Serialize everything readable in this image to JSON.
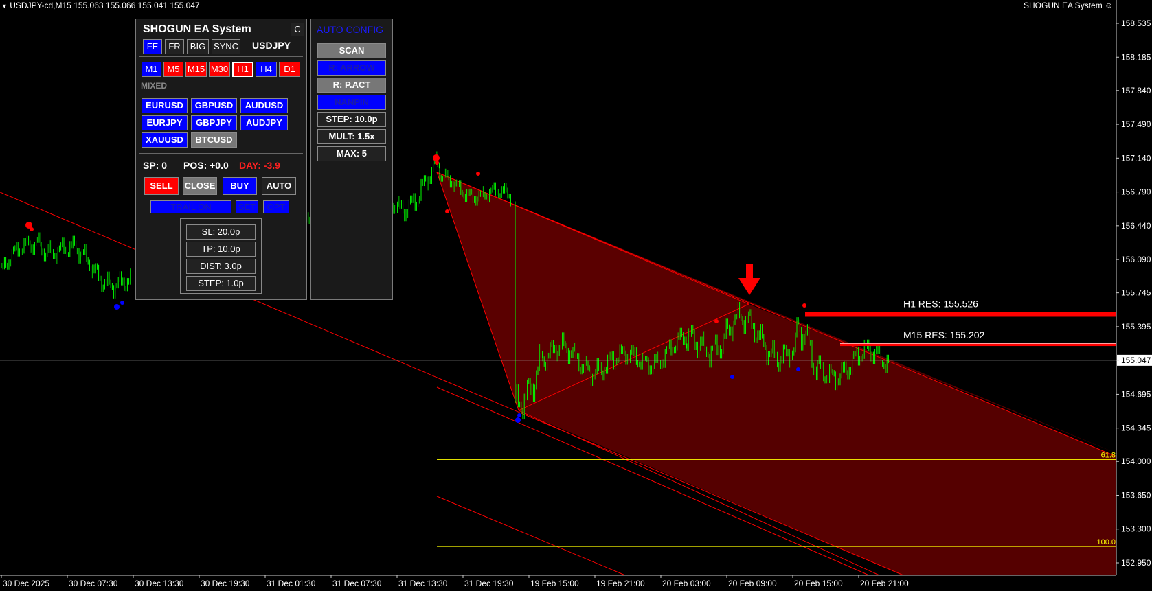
{
  "header": {
    "symbol_info": "USDJPY-cd,M15  155.063 155.066 155.041 155.047",
    "ea_label": "SHOGUN EA System ☺"
  },
  "chart_data": {
    "type": "candlestick",
    "symbol": "USDJPY-cd",
    "timeframe": "M15",
    "price_ticks": [
      "158.535",
      "158.185",
      "157.840",
      "157.490",
      "157.140",
      "156.790",
      "156.440",
      "156.090",
      "155.745",
      "155.395",
      "155.047",
      "154.695",
      "154.345",
      "154.000",
      "153.650",
      "153.300",
      "152.950"
    ],
    "current_price": "155.047",
    "time_ticks": [
      "30 Dec 2025",
      "30 Dec 07:30",
      "30 Dec 13:30",
      "30 Dec 19:30",
      "31 Dec 01:30",
      "31 Dec 07:30",
      "31 Dec 13:30",
      "31 Dec 19:30",
      "19 Feb 15:00",
      "19 Feb 21:00",
      "20 Feb 03:00",
      "20 Feb 09:00",
      "20 Feb 15:00",
      "20 Feb 21:00"
    ],
    "levels": [
      {
        "name": "H1 RES: 155.526",
        "price": 155.526,
        "color": "#ff0000"
      },
      {
        "name": "M15 RES: 155.202",
        "price": 155.202,
        "color": "#ff0000"
      }
    ],
    "fib_levels": [
      {
        "label": "61.8",
        "price": 154.02
      },
      {
        "label": "100.0",
        "price": 153.12
      }
    ],
    "colors": {
      "candles": "#00ff00",
      "channel": "#ff0000",
      "fill": "#5a0000",
      "fib": "#ffff00"
    }
  },
  "main_panel": {
    "title": "SHOGUN EA System",
    "close_btn": "C",
    "mode_buttons": [
      "FE",
      "FR",
      "BIG",
      "SYNC"
    ],
    "symbol": "USDJPY",
    "timeframes": [
      "M1",
      "M5",
      "M15",
      "M30",
      "H1",
      "H4",
      "D1"
    ],
    "mixed_label": "MIXED",
    "pairs": [
      "EURUSD",
      "GBPUSD",
      "AUDUSD",
      "EURJPY",
      "GBPJPY",
      "AUDJPY",
      "XAUUSD",
      "BTCUSD"
    ],
    "sp": "SP: 0",
    "pos": "POS: +0.0",
    "day": "DAY: -3.9",
    "sell": "SELL",
    "close": "CLOSE",
    "buy": "BUY",
    "auto": "AUTO",
    "trail": "TRAIL ON",
    "set": "SET",
    "opt": "OPT",
    "sl": "SL: 20.0p",
    "tp": "TP: 10.0p",
    "dist": "DIST: 3.0p",
    "step": "STEP: 1.0p"
  },
  "config_panel": {
    "title": "AUTO CONFIG",
    "scan": "SCAN",
    "r_arrow": "R: ARROW",
    "r_pact": "R: P.ACT",
    "nanpin": "NANPIN",
    "step": "STEP: 10.0p",
    "mult": "MULT: 1.5x",
    "max": "MAX: 5"
  }
}
